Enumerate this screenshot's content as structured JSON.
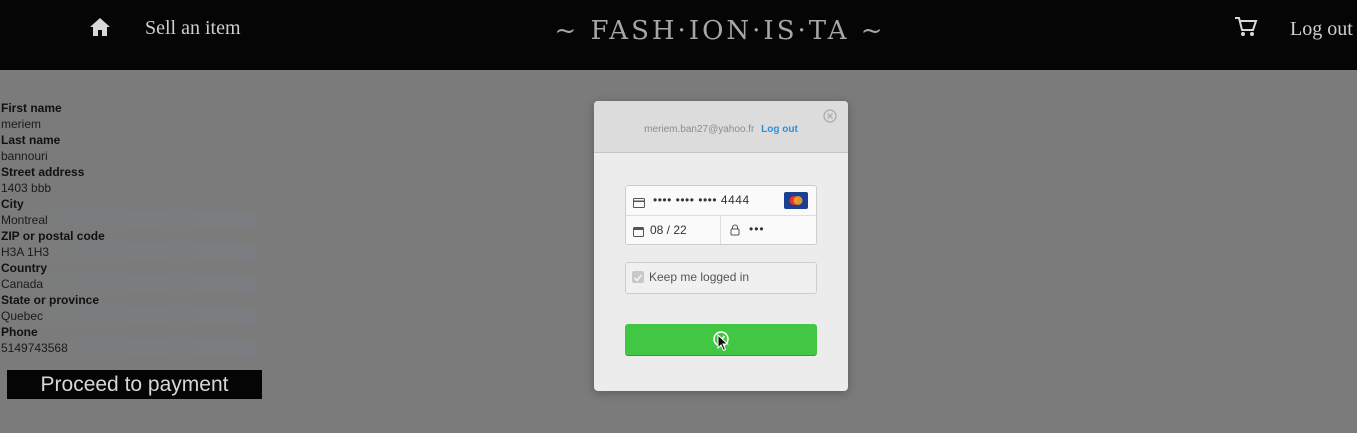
{
  "nav": {
    "home_icon": "home-icon",
    "sell_label": "Sell an item",
    "brand": "~ FASH·ION·IS·TA ~",
    "cart_icon": "cart-icon",
    "logout_label": "Log out"
  },
  "form": {
    "fields": [
      {
        "label": "First name",
        "value": "meriem"
      },
      {
        "label": "Last name",
        "value": "bannouri"
      },
      {
        "label": "Street address",
        "value": "1403 bbb"
      },
      {
        "label": "City",
        "value": "Montreal"
      },
      {
        "label": "ZIP or postal code",
        "value": "H3A 1H3"
      },
      {
        "label": "Country",
        "value": "Canada"
      },
      {
        "label": "State or province",
        "value": "Quebec"
      },
      {
        "label": "Phone",
        "value": "5149743568"
      }
    ],
    "proceed_label": "Proceed to payment"
  },
  "modal": {
    "email": "meriem.ban27@yahoo.fr",
    "logout_label": "Log out",
    "card_number": "•••• •••• •••• 4444",
    "card_brand_icon": "mastercard-icon",
    "expiry": "08 / 22",
    "cvc": "•••",
    "keep_logged_in_label": "Keep me logged in",
    "keep_logged_in_checked": true,
    "pay_button_icon": "checkmark-icon",
    "pay_button_color": "#41c743"
  }
}
